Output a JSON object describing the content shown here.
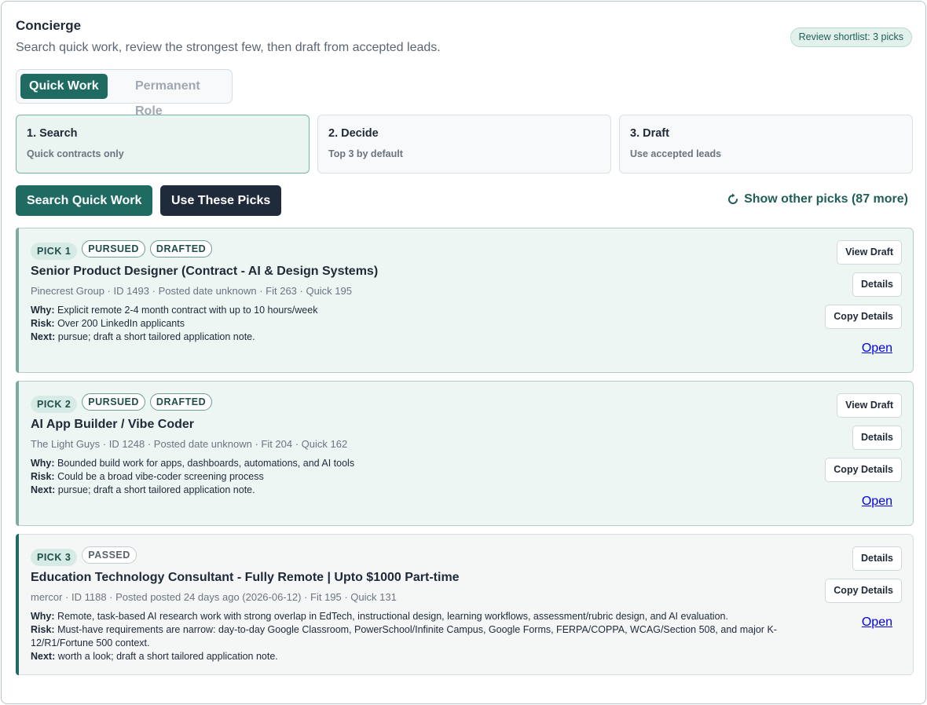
{
  "header": {
    "title": "Concierge",
    "subtitle": "Search quick work, review the strongest few, then draft from accepted leads.",
    "shortlist_badge": "Review shortlist: 3 picks"
  },
  "mode_toggle": {
    "active": "Quick Work",
    "inactive": "Permanent Role"
  },
  "steps": [
    {
      "title": "1. Search",
      "desc": "Quick contracts only",
      "active": true
    },
    {
      "title": "2. Decide",
      "desc": "Top 3 by default",
      "active": false
    },
    {
      "title": "3. Draft",
      "desc": "Use accepted leads",
      "active": false
    }
  ],
  "actions": {
    "search_label": "Search Quick Work",
    "use_picks_label": "Use These Picks",
    "other_picks_label": "Show other picks (87 more)",
    "other_picks_icon": "refresh-icon"
  },
  "picks": [
    {
      "pick_label": "PICK 1",
      "tags": [
        "PURSUED",
        "DRAFTED"
      ],
      "title": "Senior Product Designer (Contract - AI & Design Systems)",
      "meta": "Pinecrest Group · ID 1493 · Posted date unknown · Fit 263 · Quick 195",
      "why_label": "Why:",
      "why": "Explicit remote 2-4 month contract with up to 10 hours/week",
      "risk_label": "Risk:",
      "risk": "Over 200 LinkedIn applicants",
      "next_label": "Next:",
      "next": "pursue; draft a short tailored application note.",
      "buttons": {
        "view_draft": "View Draft",
        "details": "Details",
        "copy": "Copy Details",
        "open": "Open"
      }
    },
    {
      "pick_label": "PICK 2",
      "tags": [
        "PURSUED",
        "DRAFTED"
      ],
      "title": "AI App Builder / Vibe Coder",
      "meta": "The Light Guys · ID 1248 · Posted date unknown · Fit 204 · Quick 162",
      "why_label": "Why:",
      "why": "Bounded build work for apps, dashboards, automations, and AI tools",
      "risk_label": "Risk:",
      "risk": "Could be a broad vibe-coder screening process",
      "next_label": "Next:",
      "next": "pursue; draft a short tailored application note.",
      "buttons": {
        "view_draft": "View Draft",
        "details": "Details",
        "copy": "Copy Details",
        "open": "Open"
      }
    },
    {
      "pick_label": "PICK 3",
      "tags": [
        "PASSED"
      ],
      "title": "Education Technology Consultant - Fully Remote | Upto $1000 Part-time",
      "meta": "mercor · ID 1188 · Posted posted 24 days ago (2026-06-12) · Fit 195 · Quick 131",
      "why_label": "Why:",
      "why": "Remote, task-based AI research work with strong overlap in EdTech, instructional design, learning workflows, assessment/rubric design, and AI evaluation.",
      "risk_label": "Risk:",
      "risk": "Must-have requirements are narrow: day-to-day Google Classroom, PowerSchool/Infinite Campus, Google Forms, FERPA/COPPA, WCAG/Section 508, and major K-12/R1/Fortune 500 context.",
      "next_label": "Next:",
      "next": "worth a look; draft a short tailored application note.",
      "buttons": {
        "details": "Details",
        "copy": "Copy Details",
        "open": "Open"
      }
    }
  ]
}
